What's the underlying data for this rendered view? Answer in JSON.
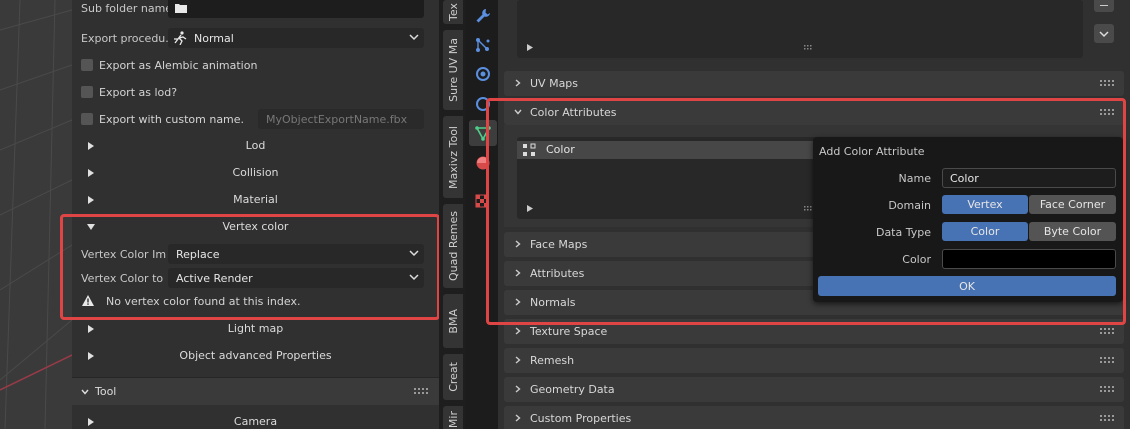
{
  "left": {
    "sub_folder_label": "Sub folder name:",
    "export_proc_label": "Export procedu...",
    "export_proc_value": "Normal",
    "check_alembic": "Export as Alembic animation",
    "check_lod": "Export as lod?",
    "check_custom": "Export with custom name.",
    "custom_name_placeholder": "MyObjectExportName.fbx",
    "sections": {
      "lod": "Lod",
      "collision": "Collision",
      "material": "Material",
      "vertex_color": "Vertex color",
      "light_map": "Light map",
      "object_advanced": "Object advanced Properties"
    },
    "vc_import_label": "Vertex Color Im",
    "vc_import_value": "Replace",
    "vc_to_label": "Vertex Color to",
    "vc_to_value": "Active Render",
    "warning": "No vertex color found at this index.",
    "tool_header": "Tool",
    "camera": "Camera"
  },
  "tabs": [
    "Tex",
    "Sure UV Ma",
    "Maxivz Tool",
    "Quad Remes",
    "BMA",
    "Creat",
    "Mir"
  ],
  "props": {
    "uv_maps": "UV Maps",
    "color_attributes": "Color Attributes",
    "color_item": "Color",
    "face_maps": "Face Maps",
    "attributes": "Attributes",
    "normals": "Normals",
    "texture_space": "Texture Space",
    "remesh": "Remesh",
    "geometry_data": "Geometry Data",
    "custom_properties": "Custom Properties"
  },
  "popup": {
    "title": "Add Color Attribute",
    "name_label": "Name",
    "name_value": "Color",
    "domain_label": "Domain",
    "domain_options": [
      "Vertex",
      "Face Corner"
    ],
    "domain_selected": "Vertex",
    "data_type_label": "Data Type",
    "data_type_options": [
      "Color",
      "Byte Color"
    ],
    "data_type_selected": "Color",
    "color_label": "Color",
    "color_value": "#000000",
    "ok": "OK"
  },
  "colors": {
    "accent": "#4772b3",
    "highlight_box": "#e04545"
  }
}
